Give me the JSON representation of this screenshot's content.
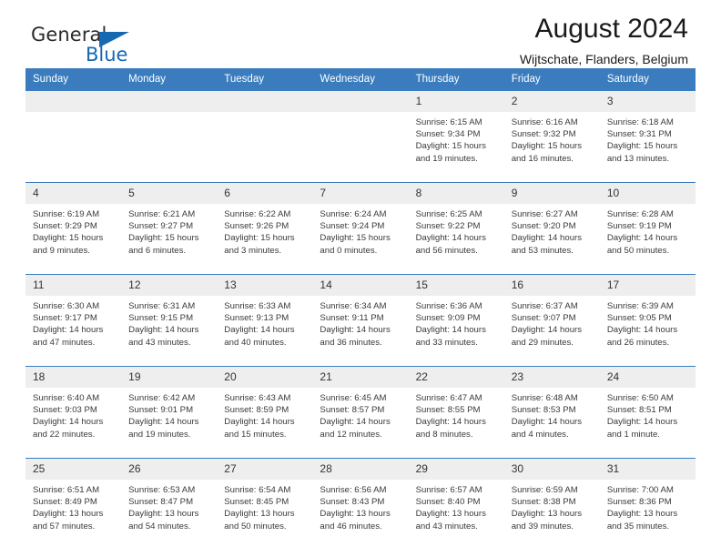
{
  "brand": {
    "name_top": "General",
    "name_bottom": "Blue",
    "triangle_color": "#1668b3",
    "text_color": "#2b2b2b"
  },
  "header": {
    "title": "August 2024",
    "subtitle": "Wijtschate, Flanders, Belgium"
  },
  "theme": {
    "header_bg": "#3a7cbe",
    "daynum_bg": "#eeeeee",
    "grid_line": "#3a7cbe"
  },
  "calendar": {
    "weekday_headers": [
      "Sunday",
      "Monday",
      "Tuesday",
      "Wednesday",
      "Thursday",
      "Friday",
      "Saturday"
    ],
    "weeks": [
      [
        {
          "day": "",
          "sunrise": "",
          "sunset": "",
          "daylight_line1": "",
          "daylight_line2": ""
        },
        {
          "day": "",
          "sunrise": "",
          "sunset": "",
          "daylight_line1": "",
          "daylight_line2": ""
        },
        {
          "day": "",
          "sunrise": "",
          "sunset": "",
          "daylight_line1": "",
          "daylight_line2": ""
        },
        {
          "day": "",
          "sunrise": "",
          "sunset": "",
          "daylight_line1": "",
          "daylight_line2": ""
        },
        {
          "day": "1",
          "sunrise": "Sunrise: 6:15 AM",
          "sunset": "Sunset: 9:34 PM",
          "daylight_line1": "Daylight: 15 hours",
          "daylight_line2": "and 19 minutes."
        },
        {
          "day": "2",
          "sunrise": "Sunrise: 6:16 AM",
          "sunset": "Sunset: 9:32 PM",
          "daylight_line1": "Daylight: 15 hours",
          "daylight_line2": "and 16 minutes."
        },
        {
          "day": "3",
          "sunrise": "Sunrise: 6:18 AM",
          "sunset": "Sunset: 9:31 PM",
          "daylight_line1": "Daylight: 15 hours",
          "daylight_line2": "and 13 minutes."
        }
      ],
      [
        {
          "day": "4",
          "sunrise": "Sunrise: 6:19 AM",
          "sunset": "Sunset: 9:29 PM",
          "daylight_line1": "Daylight: 15 hours",
          "daylight_line2": "and 9 minutes."
        },
        {
          "day": "5",
          "sunrise": "Sunrise: 6:21 AM",
          "sunset": "Sunset: 9:27 PM",
          "daylight_line1": "Daylight: 15 hours",
          "daylight_line2": "and 6 minutes."
        },
        {
          "day": "6",
          "sunrise": "Sunrise: 6:22 AM",
          "sunset": "Sunset: 9:26 PM",
          "daylight_line1": "Daylight: 15 hours",
          "daylight_line2": "and 3 minutes."
        },
        {
          "day": "7",
          "sunrise": "Sunrise: 6:24 AM",
          "sunset": "Sunset: 9:24 PM",
          "daylight_line1": "Daylight: 15 hours",
          "daylight_line2": "and 0 minutes."
        },
        {
          "day": "8",
          "sunrise": "Sunrise: 6:25 AM",
          "sunset": "Sunset: 9:22 PM",
          "daylight_line1": "Daylight: 14 hours",
          "daylight_line2": "and 56 minutes."
        },
        {
          "day": "9",
          "sunrise": "Sunrise: 6:27 AM",
          "sunset": "Sunset: 9:20 PM",
          "daylight_line1": "Daylight: 14 hours",
          "daylight_line2": "and 53 minutes."
        },
        {
          "day": "10",
          "sunrise": "Sunrise: 6:28 AM",
          "sunset": "Sunset: 9:19 PM",
          "daylight_line1": "Daylight: 14 hours",
          "daylight_line2": "and 50 minutes."
        }
      ],
      [
        {
          "day": "11",
          "sunrise": "Sunrise: 6:30 AM",
          "sunset": "Sunset: 9:17 PM",
          "daylight_line1": "Daylight: 14 hours",
          "daylight_line2": "and 47 minutes."
        },
        {
          "day": "12",
          "sunrise": "Sunrise: 6:31 AM",
          "sunset": "Sunset: 9:15 PM",
          "daylight_line1": "Daylight: 14 hours",
          "daylight_line2": "and 43 minutes."
        },
        {
          "day": "13",
          "sunrise": "Sunrise: 6:33 AM",
          "sunset": "Sunset: 9:13 PM",
          "daylight_line1": "Daylight: 14 hours",
          "daylight_line2": "and 40 minutes."
        },
        {
          "day": "14",
          "sunrise": "Sunrise: 6:34 AM",
          "sunset": "Sunset: 9:11 PM",
          "daylight_line1": "Daylight: 14 hours",
          "daylight_line2": "and 36 minutes."
        },
        {
          "day": "15",
          "sunrise": "Sunrise: 6:36 AM",
          "sunset": "Sunset: 9:09 PM",
          "daylight_line1": "Daylight: 14 hours",
          "daylight_line2": "and 33 minutes."
        },
        {
          "day": "16",
          "sunrise": "Sunrise: 6:37 AM",
          "sunset": "Sunset: 9:07 PM",
          "daylight_line1": "Daylight: 14 hours",
          "daylight_line2": "and 29 minutes."
        },
        {
          "day": "17",
          "sunrise": "Sunrise: 6:39 AM",
          "sunset": "Sunset: 9:05 PM",
          "daylight_line1": "Daylight: 14 hours",
          "daylight_line2": "and 26 minutes."
        }
      ],
      [
        {
          "day": "18",
          "sunrise": "Sunrise: 6:40 AM",
          "sunset": "Sunset: 9:03 PM",
          "daylight_line1": "Daylight: 14 hours",
          "daylight_line2": "and 22 minutes."
        },
        {
          "day": "19",
          "sunrise": "Sunrise: 6:42 AM",
          "sunset": "Sunset: 9:01 PM",
          "daylight_line1": "Daylight: 14 hours",
          "daylight_line2": "and 19 minutes."
        },
        {
          "day": "20",
          "sunrise": "Sunrise: 6:43 AM",
          "sunset": "Sunset: 8:59 PM",
          "daylight_line1": "Daylight: 14 hours",
          "daylight_line2": "and 15 minutes."
        },
        {
          "day": "21",
          "sunrise": "Sunrise: 6:45 AM",
          "sunset": "Sunset: 8:57 PM",
          "daylight_line1": "Daylight: 14 hours",
          "daylight_line2": "and 12 minutes."
        },
        {
          "day": "22",
          "sunrise": "Sunrise: 6:47 AM",
          "sunset": "Sunset: 8:55 PM",
          "daylight_line1": "Daylight: 14 hours",
          "daylight_line2": "and 8 minutes."
        },
        {
          "day": "23",
          "sunrise": "Sunrise: 6:48 AM",
          "sunset": "Sunset: 8:53 PM",
          "daylight_line1": "Daylight: 14 hours",
          "daylight_line2": "and 4 minutes."
        },
        {
          "day": "24",
          "sunrise": "Sunrise: 6:50 AM",
          "sunset": "Sunset: 8:51 PM",
          "daylight_line1": "Daylight: 14 hours",
          "daylight_line2": "and 1 minute."
        }
      ],
      [
        {
          "day": "25",
          "sunrise": "Sunrise: 6:51 AM",
          "sunset": "Sunset: 8:49 PM",
          "daylight_line1": "Daylight: 13 hours",
          "daylight_line2": "and 57 minutes."
        },
        {
          "day": "26",
          "sunrise": "Sunrise: 6:53 AM",
          "sunset": "Sunset: 8:47 PM",
          "daylight_line1": "Daylight: 13 hours",
          "daylight_line2": "and 54 minutes."
        },
        {
          "day": "27",
          "sunrise": "Sunrise: 6:54 AM",
          "sunset": "Sunset: 8:45 PM",
          "daylight_line1": "Daylight: 13 hours",
          "daylight_line2": "and 50 minutes."
        },
        {
          "day": "28",
          "sunrise": "Sunrise: 6:56 AM",
          "sunset": "Sunset: 8:43 PM",
          "daylight_line1": "Daylight: 13 hours",
          "daylight_line2": "and 46 minutes."
        },
        {
          "day": "29",
          "sunrise": "Sunrise: 6:57 AM",
          "sunset": "Sunset: 8:40 PM",
          "daylight_line1": "Daylight: 13 hours",
          "daylight_line2": "and 43 minutes."
        },
        {
          "day": "30",
          "sunrise": "Sunrise: 6:59 AM",
          "sunset": "Sunset: 8:38 PM",
          "daylight_line1": "Daylight: 13 hours",
          "daylight_line2": "and 39 minutes."
        },
        {
          "day": "31",
          "sunrise": "Sunrise: 7:00 AM",
          "sunset": "Sunset: 8:36 PM",
          "daylight_line1": "Daylight: 13 hours",
          "daylight_line2": "and 35 minutes."
        }
      ]
    ]
  }
}
